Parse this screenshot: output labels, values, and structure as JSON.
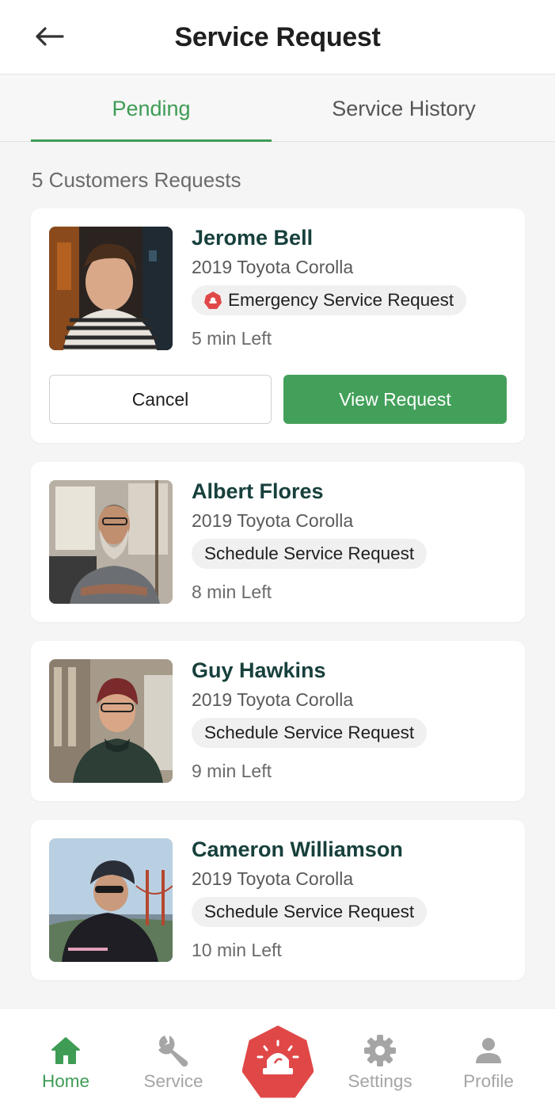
{
  "header": {
    "title": "Service Request",
    "back_icon": "arrow-left-icon"
  },
  "tabs": [
    {
      "label": "Pending",
      "active": true
    },
    {
      "label": "Service History",
      "active": false
    }
  ],
  "requests_count_label": "5 Customers Requests",
  "requests": [
    {
      "name": "Jerome Bell",
      "vehicle": "2019 Toyota Corolla",
      "service_type": "Emergency Service Request",
      "emergency": true,
      "time_left": "5 min Left",
      "cancel_label": "Cancel",
      "view_label": "View Request"
    },
    {
      "name": "Albert Flores",
      "vehicle": "2019 Toyota Corolla",
      "service_type": "Schedule Service Request",
      "emergency": false,
      "time_left": "8 min Left"
    },
    {
      "name": "Guy Hawkins",
      "vehicle": "2019 Toyota Corolla",
      "service_type": "Schedule Service Request",
      "emergency": false,
      "time_left": "9 min Left"
    },
    {
      "name": "Cameron Williamson",
      "vehicle": "2019 Toyota Corolla",
      "service_type": "Schedule Service Request",
      "emergency": false,
      "time_left": "10 min Left"
    }
  ],
  "bottom_nav": [
    {
      "label": "Home",
      "icon": "home-icon",
      "active": true
    },
    {
      "label": "Service",
      "icon": "wrench-icon",
      "active": false
    },
    {
      "label": "",
      "icon": "siren-icon",
      "active": false
    },
    {
      "label": "Settings",
      "icon": "gear-icon",
      "active": false
    },
    {
      "label": "Profile",
      "icon": "user-icon",
      "active": false
    }
  ],
  "colors": {
    "accent": "#3f9c55",
    "primary_button": "#43a05a",
    "emergency": "#e04848",
    "name_text": "#17403c",
    "background": "#f5f5f5"
  }
}
